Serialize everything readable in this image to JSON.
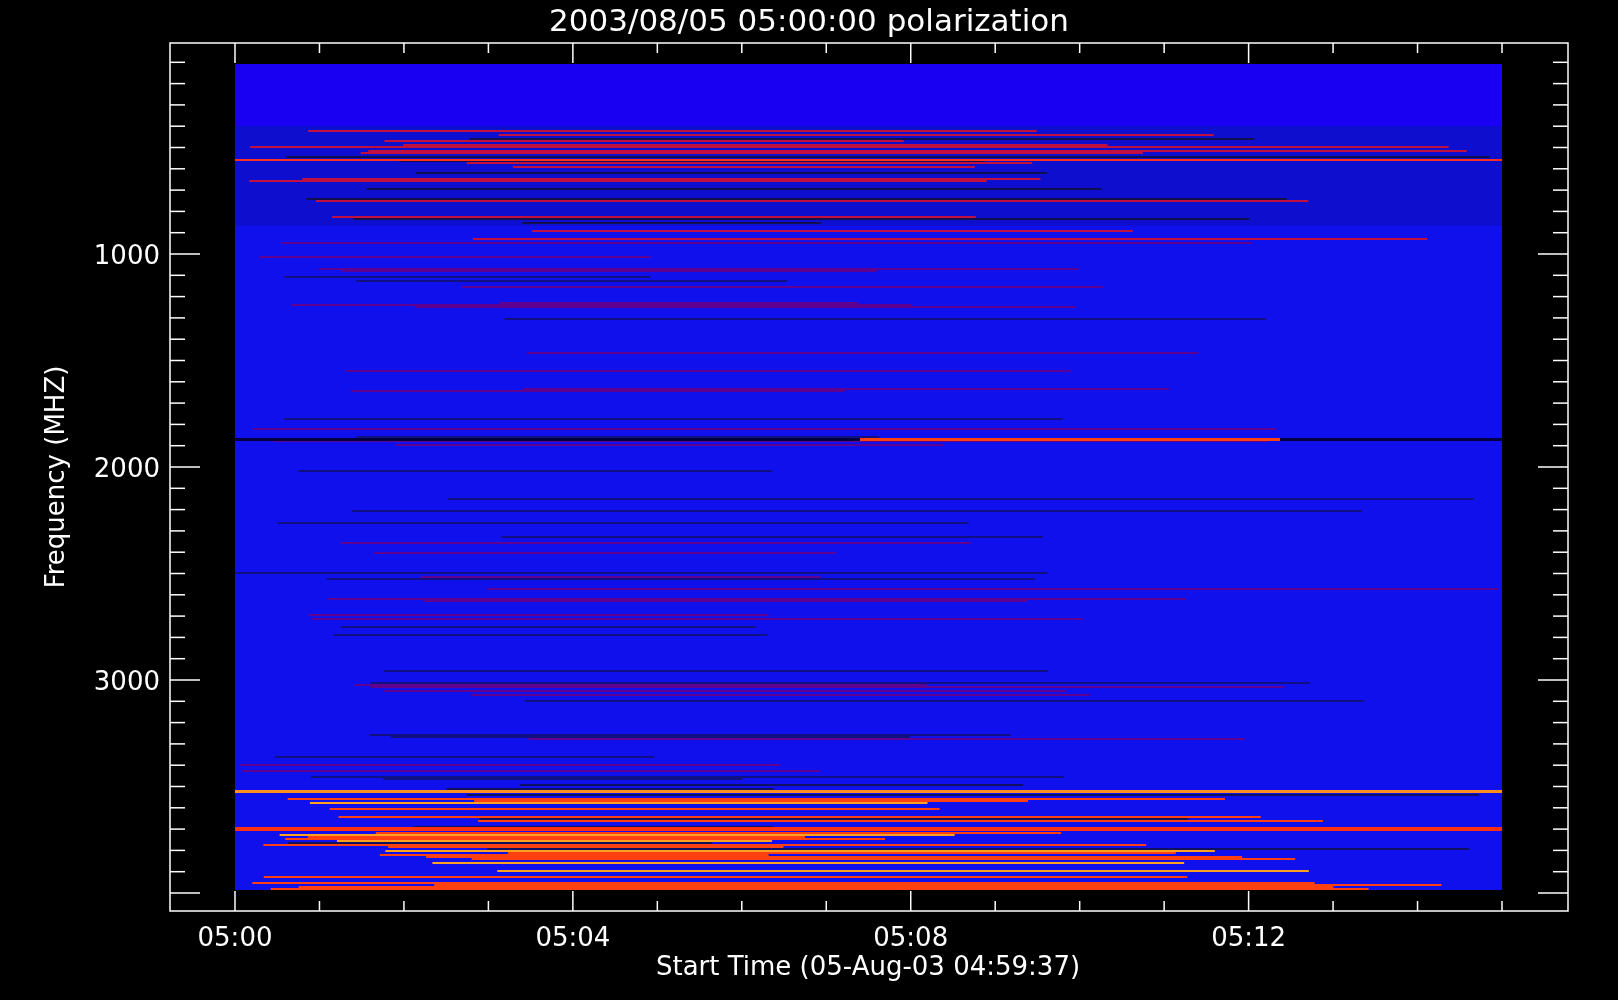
{
  "title": "2003/08/05 05:00:00 polarization",
  "y_axis": {
    "label": "Frequency (MHZ)",
    "ticks": [
      "1000",
      "2000",
      "3000"
    ]
  },
  "x_axis": {
    "label": "Start Time (05-Aug-03 04:59:37)",
    "ticks": [
      "05:00",
      "05:04",
      "05:08",
      "05:12"
    ]
  }
}
